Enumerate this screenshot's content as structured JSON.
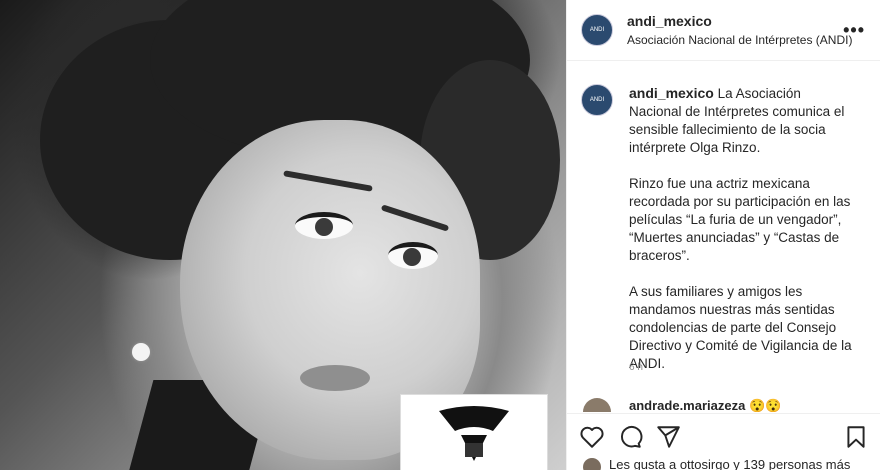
{
  "post": {
    "username": "andi_mexico",
    "subtitle": "Asociación Nacional de Intérpretes (ANDI)",
    "avatar_text": "ANDI",
    "more_label": "•••",
    "caption_username": "andi_mexico",
    "caption_p1": "La Asociación Nacional de Intérpretes comunica el sensible fallecimiento de la socia intérprete Olga Rinzo.",
    "caption_p2": "Rinzo fue una actriz mexicana recordada por su participación en las películas “La furia de un vengador”, “Muertes anunciadas” y “Castas de braceros”.",
    "caption_p3": "A sus familiares y amigos les mandamos nuestras más sentidas condolencias de parte del Consejo Directivo y Comité de Vigilancia de la ANDI.",
    "time": "6 h"
  },
  "comment": {
    "username": "andrade.mariazeza 😯😯"
  },
  "actions": {
    "icons": [
      "heart-icon",
      "comment-icon",
      "share-icon",
      "bookmark-icon"
    ]
  },
  "likes": {
    "text": "Les gusta a ottosirgo y 139 personas más"
  }
}
